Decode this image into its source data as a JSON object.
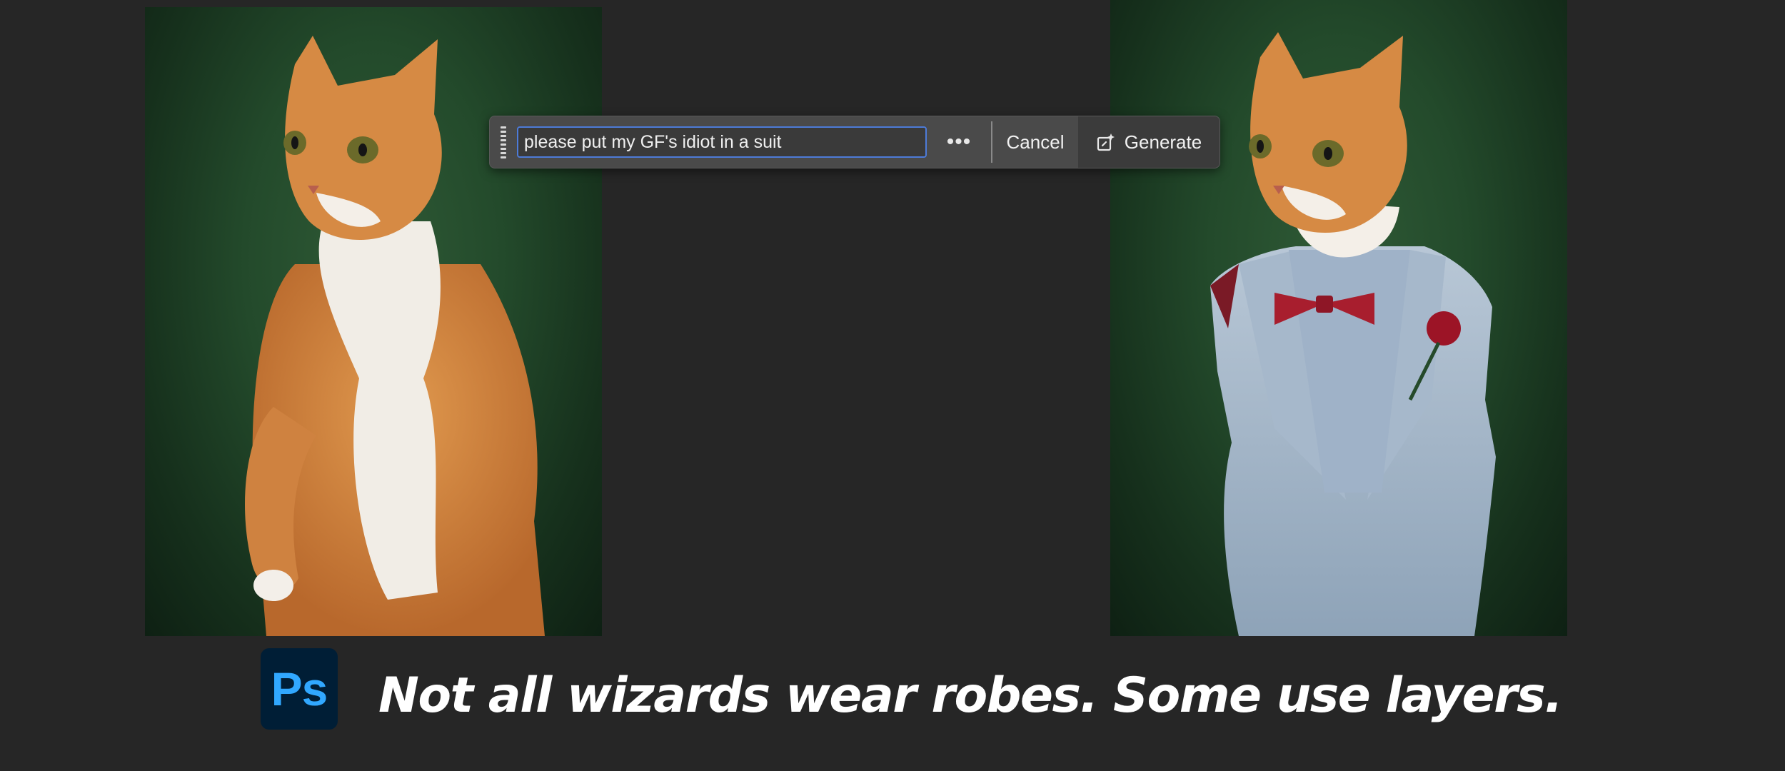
{
  "prompt_bar": {
    "prompt_value": "please put my GF's idiot in a suit",
    "more_label": "•••",
    "cancel_label": "Cancel",
    "generate_label": "Generate"
  },
  "branding": {
    "logo_text": "Ps",
    "tagline": "Not all wizards wear robes. Some use layers."
  },
  "images": {
    "left": "orange-white-cat-photo",
    "right": "orange-white-cat-in-suit-photo"
  },
  "colors": {
    "background": "#262626",
    "input_focus": "#4d7bd8",
    "ps_blue": "#31a8ff",
    "ps_bg": "#001e36"
  }
}
